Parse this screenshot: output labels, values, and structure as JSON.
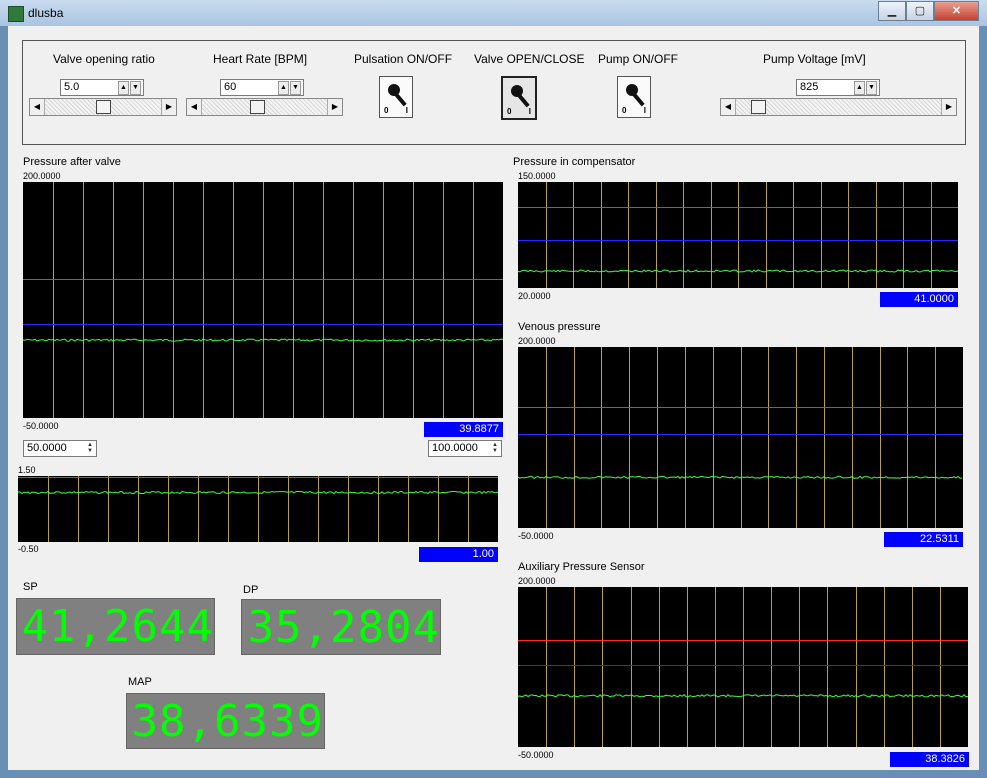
{
  "window": {
    "title": "dlusba",
    "min_glyph": "▁",
    "max_glyph": "▢",
    "close_glyph": "✕"
  },
  "controls": {
    "valve_ratio": {
      "label": "Valve opening ratio",
      "value": "5.0"
    },
    "heart_rate": {
      "label": "Heart Rate [BPM]",
      "value": "60"
    },
    "pulsation": {
      "label": "Pulsation ON/OFF",
      "off": "0",
      "on": "I"
    },
    "valve": {
      "label": "Valve OPEN/CLOSE",
      "off": "0",
      "on": "I"
    },
    "pump": {
      "label": "Pump ON/OFF",
      "off": "0",
      "on": "I"
    },
    "pump_voltage": {
      "label": "Pump Voltage [mV]",
      "value": "825"
    }
  },
  "graphs": {
    "after_valve": {
      "title": "Pressure after valve",
      "max": "200.0000",
      "min": "-50.0000",
      "readout": "39.8877",
      "left_box": "50.0000",
      "right_box": "100.0000"
    },
    "small": {
      "max": "1.50",
      "min": "-0.50",
      "readout": "1.00"
    },
    "compensator": {
      "title": "Pressure in compensator",
      "max": "150.0000",
      "min": "20.0000",
      "readout": "41.0000"
    },
    "venous": {
      "title": "Venous pressure",
      "max": "200.0000",
      "min": "-50.0000",
      "readout": "22.5311"
    },
    "aux": {
      "title": "Auxiliary Pressure Sensor",
      "max": "200.0000",
      "min": "-50.0000",
      "readout": "38.3826"
    }
  },
  "lcd": {
    "sp": {
      "label": "SP",
      "value": "41,2644"
    },
    "dp": {
      "label": "DP",
      "value": "35,2804"
    },
    "map": {
      "label": "MAP",
      "value": "38,6339"
    }
  },
  "colors": {
    "red_line": "#ff2a2a",
    "blue_line": "#2a2aff",
    "signal": "#3cff3c",
    "grid": "#b8a33a"
  }
}
